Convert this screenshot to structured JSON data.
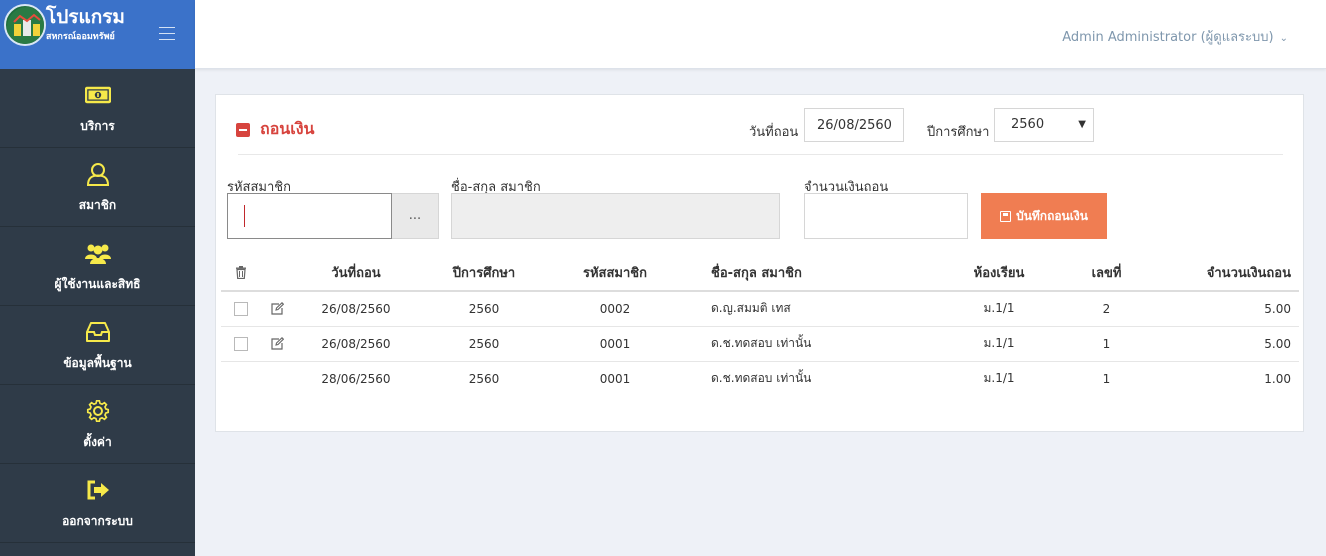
{
  "brand": {
    "title": "โปรแกรม",
    "subtitle": "สหกรณ์ออมทรัพย์"
  },
  "nav": [
    {
      "label": "บริการ",
      "icon": "money-icon"
    },
    {
      "label": "สมาชิก",
      "icon": "user-icon"
    },
    {
      "label": "ผู้ใช้งานและสิทธิ",
      "icon": "users-icon"
    },
    {
      "label": "ข้อมูลพื้นฐาน",
      "icon": "inbox-icon"
    },
    {
      "label": "ตั้งค่า",
      "icon": "gear-icon"
    },
    {
      "label": "ออกจากระบบ",
      "icon": "sign-out-icon"
    }
  ],
  "topbar": {
    "user": "Admin Administrator (ผู้ดูแลระบบ)"
  },
  "panel": {
    "title": "ถอนเงิน",
    "date_label": "วันที่ถอน",
    "date_value": "26/08/2560",
    "year_label": "ปีการศึกษา",
    "year_value": "2560",
    "member_id_label": "รหัสสมาชิก",
    "member_name_label": "ชื่อ-สกุล สมาชิก",
    "amount_label": "จำนวนเงินถอน",
    "search_button": "...",
    "save_button": "บันทึกถอนเงิน"
  },
  "colors": {
    "sidebar": "#2f3b48",
    "brand": "#3b72c9",
    "accent": "#d7443e",
    "button": "#f07d52",
    "icon": "#f6e94a"
  },
  "table": {
    "headers": [
      "วันที่ถอน",
      "ปีการศึกษา",
      "รหัสสมาชิก",
      "ชื่อ-สกุล สมาชิก",
      "ห้องเรียน",
      "เลขที่",
      "จำนวนเงินถอน"
    ],
    "rows": [
      {
        "date": "26/08/2560",
        "year": "2560",
        "id": "0002",
        "name": "ด.ญ.สมมติ เทส",
        "room": "ม.1/1",
        "no": "2",
        "amount": "5.00"
      },
      {
        "date": "26/08/2560",
        "year": "2560",
        "id": "0001",
        "name": "ด.ช.ทดสอบ เท่านั้น",
        "room": "ม.1/1",
        "no": "1",
        "amount": "5.00"
      },
      {
        "date": "28/06/2560",
        "year": "2560",
        "id": "0001",
        "name": "ด.ช.ทดสอบ เท่านั้น",
        "room": "ม.1/1",
        "no": "1",
        "amount": "1.00"
      }
    ]
  }
}
